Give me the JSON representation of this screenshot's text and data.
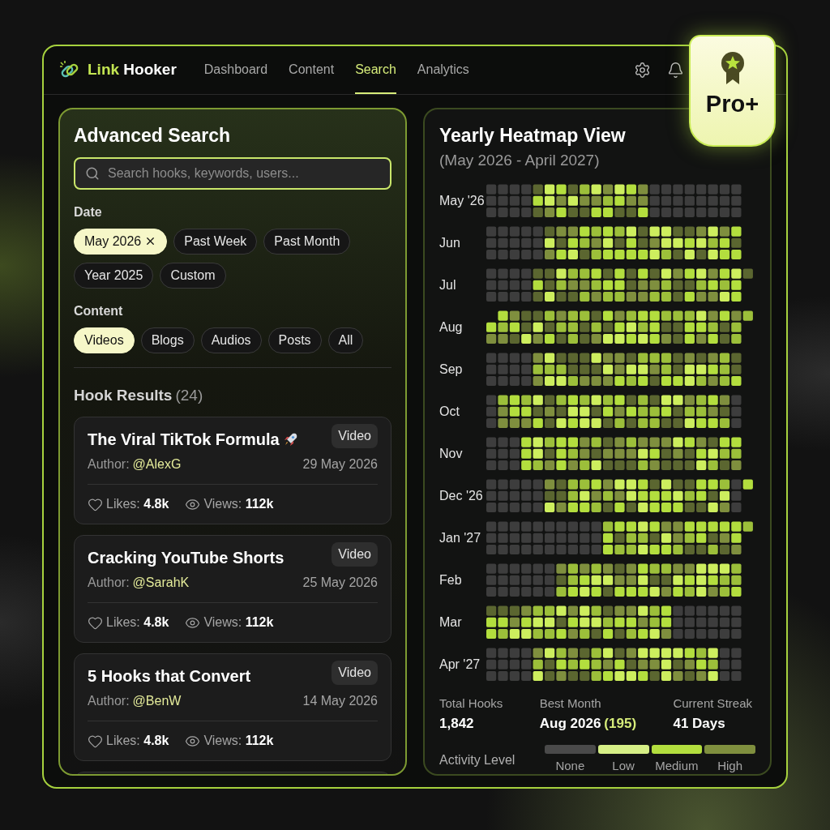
{
  "brand": {
    "first": "Link",
    "second": "Hooker"
  },
  "nav": [
    {
      "label": "Dashboard",
      "selected": false
    },
    {
      "label": "Content",
      "selected": false
    },
    {
      "label": "Search",
      "selected": true
    },
    {
      "label": "Analytics",
      "selected": false
    }
  ],
  "badge": {
    "label": "Pro+"
  },
  "search_panel": {
    "title": "Advanced Search",
    "search": {
      "placeholder": "Search hooks, keywords, users..."
    },
    "date_label": "Date",
    "date_filters": [
      {
        "label": "May 2026",
        "selected": true
      },
      {
        "label": "Past Week",
        "selected": false
      },
      {
        "label": "Past Month",
        "selected": false
      },
      {
        "label": "Year 2025",
        "selected": false
      },
      {
        "label": "Custom",
        "selected": false
      }
    ],
    "content_label": "Content",
    "content_filters": [
      {
        "label": "Videos",
        "selected": true
      },
      {
        "label": "Blogs",
        "selected": false
      },
      {
        "label": "Audios",
        "selected": false
      },
      {
        "label": "Posts",
        "selected": false
      },
      {
        "label": "All",
        "selected": false
      }
    ],
    "results_title": "Hook Results",
    "results_count": "(24)",
    "results": [
      {
        "title": "The Viral TikTok Formula",
        "rocket": true,
        "type": "Video",
        "author_label": "Author:",
        "author": "@AlexG",
        "date": "29 May 2026",
        "likes": "Likes: **4.8k**",
        "views": "Views: **112k**"
      },
      {
        "title": "Cracking YouTube Shorts",
        "rocket": false,
        "type": "Video",
        "author_label": "Author:",
        "author": "@SarahK",
        "date": "25 May 2026",
        "likes": "Likes: **4.8k**",
        "views": "Views: **112k**"
      },
      {
        "title": "5 Hooks that Convert",
        "rocket": false,
        "type": "Video",
        "author_label": "Author:",
        "author": "@BenW",
        "date": "14 May 2026",
        "likes": "Likes: **4.8k**",
        "views": "Views: **112k**"
      }
    ]
  },
  "heatmap": {
    "title": "Yearly Heatmap View",
    "subtitle": "(May 2026 - April 2027)",
    "months": [
      "May '26",
      "Jun",
      "Jul",
      "Aug",
      "Sep",
      "Oct",
      "Nov",
      "Dec '26",
      "Jan '27",
      "Feb",
      "Mar",
      "Apr '27"
    ],
    "stats": [
      {
        "label": "Total Hooks",
        "value": "1,842"
      },
      {
        "label": "Best Month",
        "value": "Aug 2026",
        "extra": "(195)"
      },
      {
        "label": "Current Streak",
        "value": "41 Days"
      }
    ],
    "legend_label": "Activity Level",
    "legend": [
      {
        "label": "None",
        "color": "#4a4a4a"
      },
      {
        "label": "Low",
        "color": "#d6ef86"
      },
      {
        "label": "Medium",
        "color": "#b3de3e"
      },
      {
        "label": "High",
        "color": "#7f8f3e"
      }
    ]
  }
}
